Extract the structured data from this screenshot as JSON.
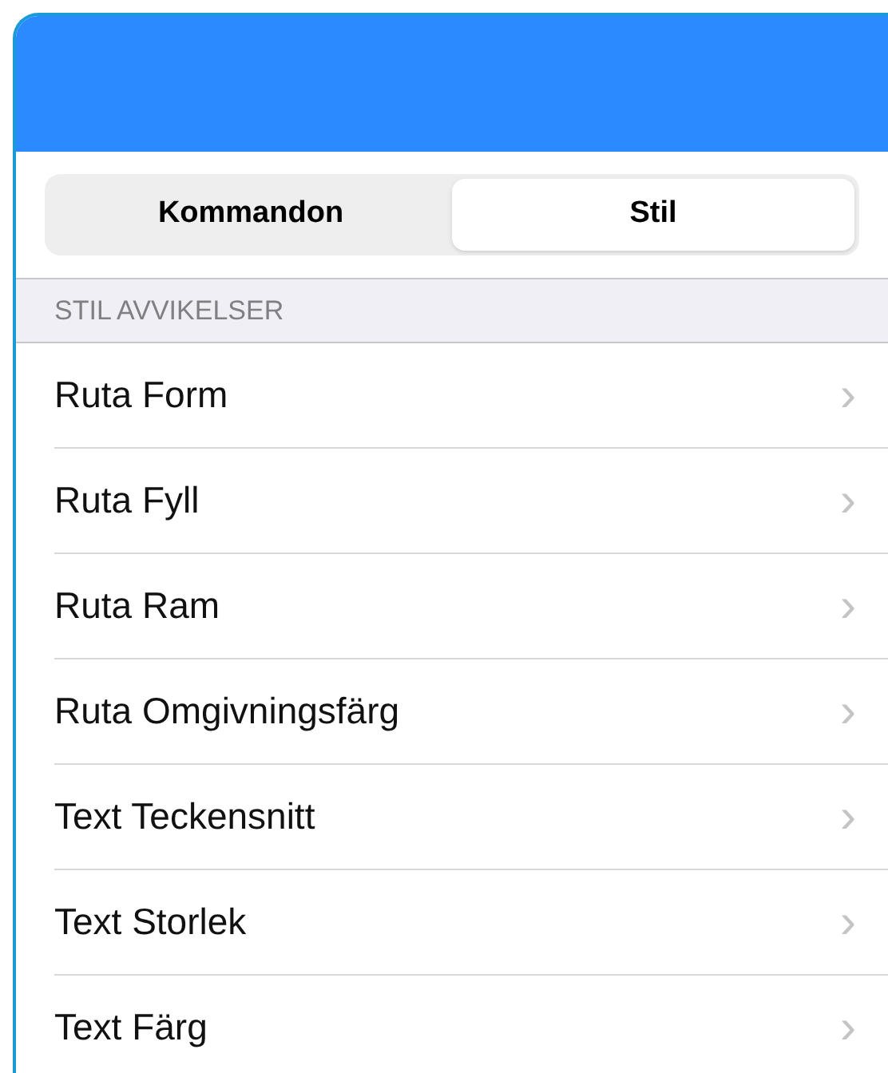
{
  "segments": [
    {
      "label": "Kommandon",
      "selected": false
    },
    {
      "label": "Stil",
      "selected": true
    }
  ],
  "section": {
    "title": "STIL AVVIKELSER"
  },
  "items": [
    {
      "label": "Ruta Form",
      "chevron": "›"
    },
    {
      "label": "Ruta Fyll",
      "chevron": "›"
    },
    {
      "label": "Ruta Ram",
      "chevron": "›"
    },
    {
      "label": "Ruta Omgivningsfärg",
      "chevron": "›"
    },
    {
      "label": "Text Teckensnitt",
      "chevron": "›"
    },
    {
      "label": "Text Storlek",
      "chevron": "›"
    },
    {
      "label": "Text Färg",
      "chevron": "›"
    }
  ]
}
